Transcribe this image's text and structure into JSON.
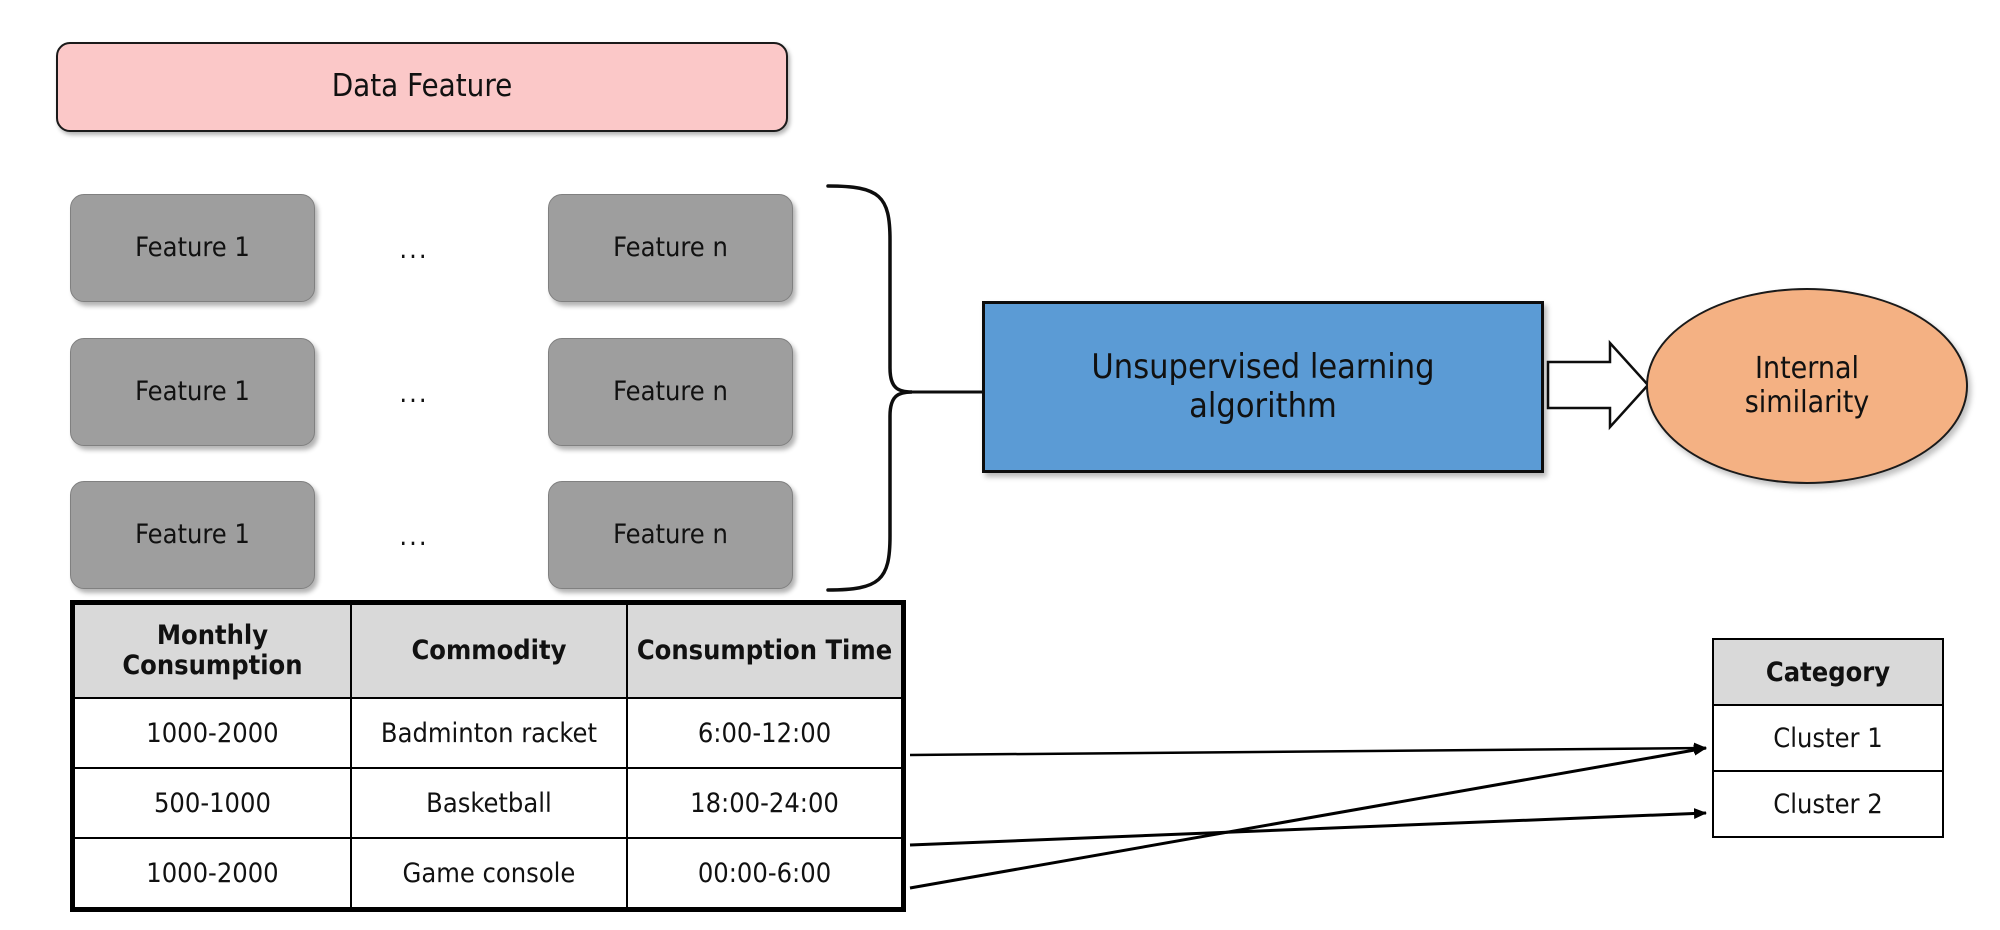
{
  "diagram": {
    "title_box": {
      "label": "Data Feature"
    },
    "feature_grid": {
      "ellipsis": "...",
      "rows": [
        {
          "first": "Feature 1",
          "last": "Feature n"
        },
        {
          "first": "Feature 1",
          "last": "Feature n"
        },
        {
          "first": "Feature 1",
          "last": "Feature n"
        }
      ]
    },
    "algorithm_box": {
      "line1": "Unsupervised learning",
      "line2": "algorithm"
    },
    "result_ellipse": {
      "line1": "Internal",
      "line2": "similarity"
    },
    "data_table": {
      "headers": [
        "Monthly Consumption",
        "Commodity",
        "Consumption Time"
      ],
      "header_lines": [
        [
          "Monthly",
          "Consumption"
        ],
        [
          "Commodity"
        ],
        [
          "Consumption Time"
        ]
      ],
      "rows": [
        [
          "1000-2000",
          "Badminton racket",
          "6:00-12:00"
        ],
        [
          "500-1000",
          "Basketball",
          "18:00-24:00"
        ],
        [
          "1000-2000",
          "Game console",
          "00:00-6:00"
        ]
      ]
    },
    "category_table": {
      "header": "Category",
      "rows": [
        "Cluster 1",
        "Cluster 2"
      ]
    },
    "colors": {
      "data_feature_fill": "#FBC8C8",
      "feature_fill": "#9E9E9E",
      "algorithm_fill": "#5B9BD5",
      "ellipse_fill": "#F4B183",
      "table_header_fill": "#D9D9D9",
      "stroke": "#000000",
      "background": "#FFFFFF"
    }
  }
}
